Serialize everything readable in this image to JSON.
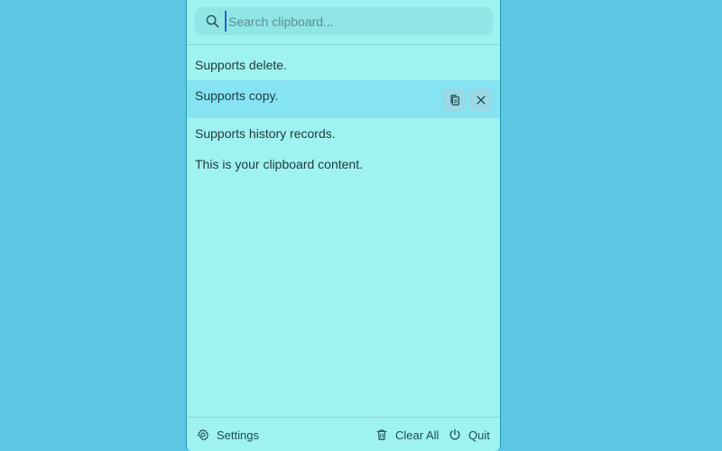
{
  "search": {
    "placeholder": "Search clipboard...",
    "value": ""
  },
  "clipboard": {
    "items": [
      {
        "text": "Supports delete."
      },
      {
        "text": "Supports copy."
      },
      {
        "text": "Supports history records."
      },
      {
        "text": "This is your clipboard content."
      }
    ],
    "active_index": 1
  },
  "footer": {
    "settings_label": "Settings",
    "clear_all_label": "Clear All",
    "quit_label": "Quit"
  },
  "colors": {
    "background": "#5bc7e2",
    "panel": "#9ef2f0",
    "active_row": "#86e4f2"
  },
  "icons": {
    "search": "search-icon",
    "copy": "copy-icon",
    "delete": "close-icon",
    "settings": "gear-icon",
    "clear_all": "trash-icon",
    "quit": "power-icon"
  }
}
